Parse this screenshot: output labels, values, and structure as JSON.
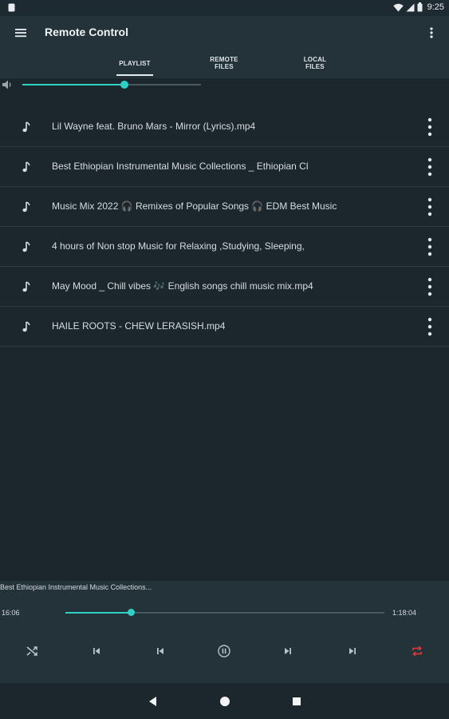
{
  "status_bar": {
    "time": "9:25"
  },
  "app_bar": {
    "title": "Remote Control"
  },
  "tabs": [
    {
      "line1": "PLAYLIST",
      "line2": "",
      "active": true
    },
    {
      "line1": "REMOTE",
      "line2": "FILES",
      "active": false
    },
    {
      "line1": "LOCAL",
      "line2": "FILES",
      "active": false
    }
  ],
  "volume": {
    "level": 0.57
  },
  "playlist": {
    "items": [
      {
        "name": "Lil Wayne feat. Bruno Mars - Mirror (Lyrics).mp4"
      },
      {
        "name": "Best Ethiopian Instrumental Music Collections _ Ethiopian Cl"
      },
      {
        "name": "Music Mix 2022 🎧 Remixes of Popular Songs 🎧 EDM Best Music"
      },
      {
        "name": "4 hours of Non stop Music for Relaxing ,Studying, Sleeping,"
      },
      {
        "name": "May Mood _ Chill vibes 🎶 English songs chill music mix.mp4"
      },
      {
        "name": "HAILE ROOTS - CHEW LERASISH.mp4"
      }
    ]
  },
  "now_playing": {
    "title": "Best Ethiopian Instrumental Music Collections...",
    "current_time": "16:06",
    "total_time": "1:18:04",
    "progress": 0.206
  },
  "colors": {
    "accent": "#2fd1c7",
    "repeat_active": "#e53935",
    "background": "#1b262d",
    "surface": "#24323a"
  },
  "icons": {
    "menu": "hamburger-menu-icon",
    "overflow": "more-vert-icon",
    "volume": "volume-icon",
    "track": "music-note-icon",
    "shuffle": "shuffle-icon",
    "skip_previous": "skip-previous-icon",
    "rewind": "previous-icon",
    "pause": "pause-circle-icon",
    "fast_forward": "next-icon",
    "skip_next": "skip-next-icon",
    "repeat": "repeat-icon"
  }
}
